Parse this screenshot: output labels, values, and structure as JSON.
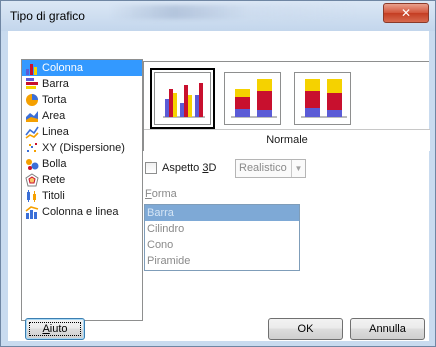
{
  "window": {
    "title": "Tipo di grafico",
    "close_glyph": "✕"
  },
  "chart_types": [
    {
      "label": "Colonna",
      "icon": "column-chart-icon",
      "selected": true
    },
    {
      "label": "Barra",
      "icon": "bar-chart-icon"
    },
    {
      "label": "Torta",
      "icon": "pie-chart-icon"
    },
    {
      "label": "Area",
      "icon": "area-chart-icon"
    },
    {
      "label": "Linea",
      "icon": "line-chart-icon"
    },
    {
      "label": "XY (Dispersione)",
      "icon": "scatter-chart-icon"
    },
    {
      "label": "Bolla",
      "icon": "bubble-chart-icon"
    },
    {
      "label": "Rete",
      "icon": "net-chart-icon"
    },
    {
      "label": "Titoli",
      "icon": "stock-chart-icon"
    },
    {
      "label": "Colonna e linea",
      "icon": "column-line-chart-icon"
    }
  ],
  "variants": {
    "caption": "Normale",
    "selected_index": 0,
    "items": [
      "normal-column-variant-icon",
      "stacked-column-variant-icon",
      "percent-stacked-column-variant-icon"
    ]
  },
  "aspect_3d": {
    "label_prefix": "Aspetto ",
    "label_underlined": "3",
    "label_suffix": "D",
    "checked": false,
    "select_value": "Realistico"
  },
  "shape": {
    "label_underlined": "F",
    "label_rest": "orma",
    "options": [
      "Barra",
      "Cilindro",
      "Cono",
      "Piramide"
    ],
    "selected": "Barra"
  },
  "buttons": {
    "help_underlined": "A",
    "help_rest": "iuto",
    "ok": "OK",
    "cancel": "Annulla"
  },
  "colors": {
    "series_blue": "#5b5bd6",
    "series_red": "#c8102e",
    "series_yellow": "#f5d200",
    "selection": "#3399ff"
  }
}
